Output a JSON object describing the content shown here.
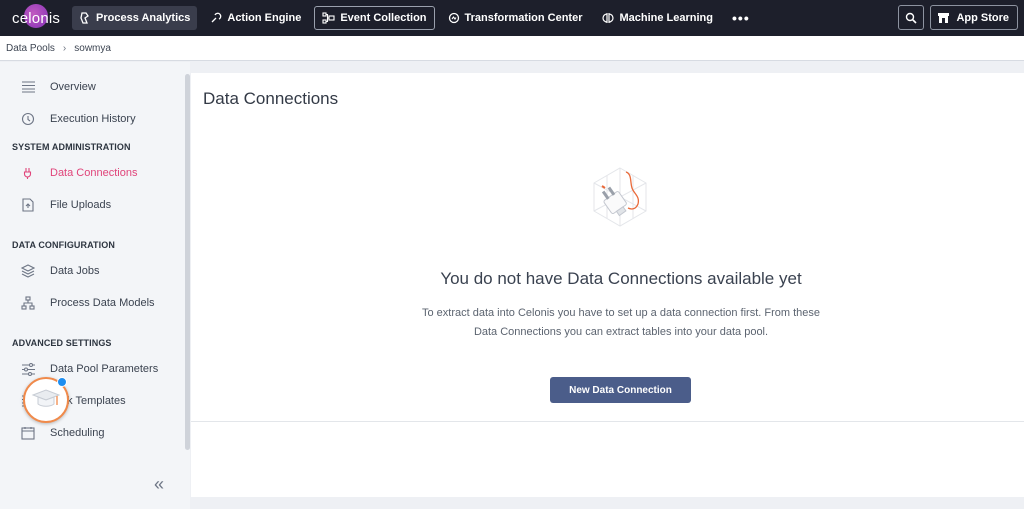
{
  "app": {
    "logo_text": "celonis"
  },
  "nav": {
    "items": [
      {
        "label": "Process Analytics",
        "icon": "process-analytics-icon"
      },
      {
        "label": "Action Engine",
        "icon": "action-engine-icon"
      },
      {
        "label": "Event Collection",
        "icon": "event-collection-icon"
      },
      {
        "label": "Transformation Center",
        "icon": "transformation-center-icon"
      },
      {
        "label": "Machine Learning",
        "icon": "machine-learning-icon"
      }
    ],
    "more": "•••",
    "app_store": "App Store"
  },
  "breadcrumb": {
    "root": "Data Pools",
    "separator": "›",
    "current": "sowmya"
  },
  "sidebar": {
    "overview": "Overview",
    "execution_history": "Execution History",
    "section_system": "SYSTEM ADMINISTRATION",
    "data_connections": "Data Connections",
    "file_uploads": "File Uploads",
    "section_data": "DATA CONFIGURATION",
    "data_jobs": "Data Jobs",
    "process_data_models": "Process Data Models",
    "section_advanced": "ADVANCED SETTINGS",
    "data_pool_parameters": "Data Pool Parameters",
    "task_templates": "Task Templates",
    "scheduling": "Scheduling",
    "collapse": "«"
  },
  "main": {
    "title": "Data Connections",
    "empty_title": "You do not have Data Connections available yet",
    "empty_desc": "To extract data into Celonis you have to set up a data connection first. From these Data Connections you can extract tables into your data pool.",
    "new_button": "New Data Connection"
  },
  "colors": {
    "accent_pink": "#e0447a",
    "primary_button": "#4b5d8a",
    "topbar": "#1d1f2b",
    "help_ring": "#f08a4b",
    "notification_dot": "#1e8ef0"
  }
}
